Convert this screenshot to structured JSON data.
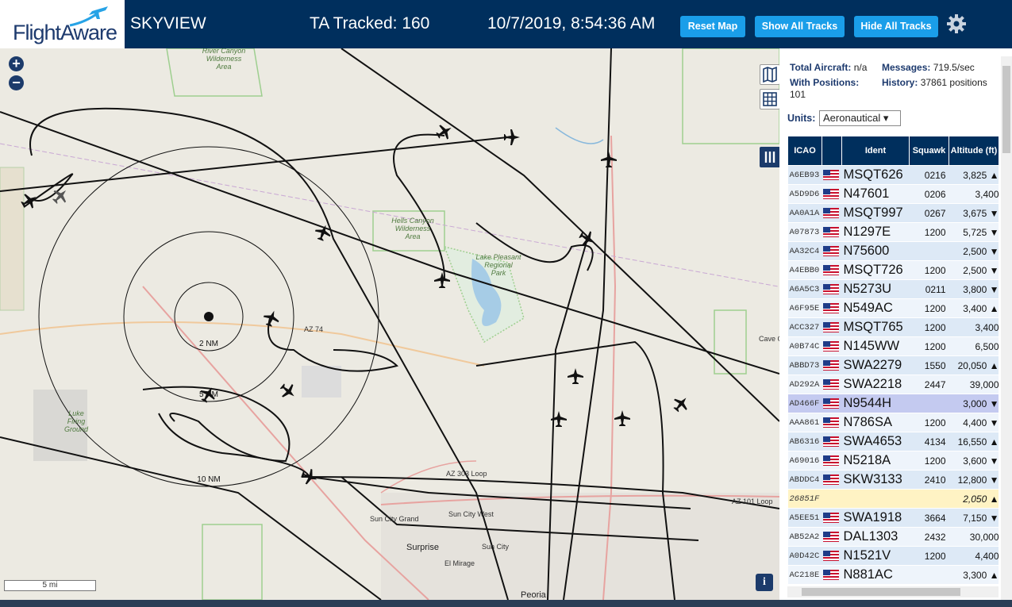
{
  "header": {
    "logo_text": "FlightAware",
    "title": "SKYVIEW",
    "tracked": "TA Tracked: 160",
    "datetime": "10/7/2019, 8:54:36 AM",
    "buttons": {
      "reset": "Reset Map",
      "show_all": "Show All Tracks",
      "hide_all": "Hide All Tracks"
    }
  },
  "map": {
    "labels": {
      "river_canyon": "River Canyon\nWilderness\nArea",
      "hells_canyon": "Hells Canyon\nWilderness\nArea",
      "lake_pleasant": "Lake Pleasant\nRegional\nPark",
      "luke": "Luke\nFiring\nGround",
      "ring_2": "2 NM",
      "ring_5": "5 NM",
      "ring_10": "10 NM",
      "az74": "AZ 74",
      "az303": "AZ 303 Loop",
      "az101": "AZ 101 Loop",
      "sun_city_grand": "Sun City Grand",
      "sun_city_west": "Sun City West",
      "sun_city": "Sun City",
      "surprise": "Surprise",
      "el_mirage": "El Mirage",
      "peoria": "Peoria",
      "cave_creek": "Cave Cr",
      "scale": "5 mi"
    },
    "info": "i",
    "zoom_in": "+",
    "zoom_out": "−"
  },
  "panel": {
    "total_label": "Total Aircraft:",
    "total_value": "n/a",
    "messages_label": "Messages:",
    "messages_value": "719.5/sec",
    "positions_label": "With Positions:",
    "positions_value": "101",
    "history_label": "History:",
    "history_value": "37861 positions",
    "units_label": "Units:",
    "units_value": "Aeronautical ▾",
    "columns": [
      "ICAO",
      "",
      "Ident",
      "Squawk",
      "Altitude (ft)"
    ],
    "rows": [
      {
        "icao": "A6EB93",
        "ident": "MSQT626",
        "squawk": "0216",
        "alt": "3,825 ▲",
        "flag": true
      },
      {
        "icao": "A5D9D6",
        "ident": "N47601",
        "squawk": "0206",
        "alt": "3,400",
        "flag": true
      },
      {
        "icao": "AA0A1A",
        "ident": "MSQT997",
        "squawk": "0267",
        "alt": "3,675 ▼",
        "flag": true
      },
      {
        "icao": "A07873",
        "ident": "N1297E",
        "squawk": "1200",
        "alt": "5,725 ▼",
        "flag": true
      },
      {
        "icao": "AA32C4",
        "ident": "N75600",
        "squawk": "",
        "alt": "2,500 ▼",
        "flag": true
      },
      {
        "icao": "A4EBB0",
        "ident": "MSQT726",
        "squawk": "1200",
        "alt": "2,500 ▼",
        "flag": true
      },
      {
        "icao": "A6A5C3",
        "ident": "N5273U",
        "squawk": "0211",
        "alt": "3,800 ▼",
        "flag": true
      },
      {
        "icao": "A6F95E",
        "ident": "N549AC",
        "squawk": "1200",
        "alt": "3,400 ▲",
        "flag": true
      },
      {
        "icao": "ACC327",
        "ident": "MSQT765",
        "squawk": "1200",
        "alt": "3,400",
        "flag": true
      },
      {
        "icao": "A0B74C",
        "ident": "N145WW",
        "squawk": "1200",
        "alt": "6,500",
        "flag": true
      },
      {
        "icao": "ABBD73",
        "ident": "SWA2279",
        "squawk": "1550",
        "alt": "20,050 ▲",
        "flag": true
      },
      {
        "icao": "AD292A",
        "ident": "SWA2218",
        "squawk": "2447",
        "alt": "39,000",
        "flag": true
      },
      {
        "icao": "AD466F",
        "ident": "N9544H",
        "squawk": "",
        "alt": "3,000 ▼",
        "flag": true,
        "selected": true
      },
      {
        "icao": "AAA861",
        "ident": "N786SA",
        "squawk": "1200",
        "alt": "4,400 ▼",
        "flag": true
      },
      {
        "icao": "AB6316",
        "ident": "SWA4653",
        "squawk": "4134",
        "alt": "16,550 ▲",
        "flag": true
      },
      {
        "icao": "A69016",
        "ident": "N5218A",
        "squawk": "1200",
        "alt": "3,600 ▼",
        "flag": true
      },
      {
        "icao": "ABDDC4",
        "ident": "SKW3133",
        "squawk": "2410",
        "alt": "12,800 ▼",
        "flag": true
      },
      {
        "icao": "26851F",
        "ident": "",
        "squawk": "",
        "alt": "2,050 ▲",
        "flag": false,
        "nopos": true
      },
      {
        "icao": "A5EE51",
        "ident": "SWA1918",
        "squawk": "3664",
        "alt": "7,150 ▼",
        "flag": true
      },
      {
        "icao": "AB52A2",
        "ident": "DAL1303",
        "squawk": "2432",
        "alt": "30,000",
        "flag": true
      },
      {
        "icao": "A0D42C",
        "ident": "N1521V",
        "squawk": "1200",
        "alt": "4,400",
        "flag": true
      },
      {
        "icao": "AC218E",
        "ident": "N881AC",
        "squawk": "",
        "alt": "3,300 ▲",
        "flag": true
      }
    ]
  },
  "colors": {
    "header_bg": "#002f5d",
    "button": "#1a9ee9",
    "accent": "#1d3a6e"
  }
}
